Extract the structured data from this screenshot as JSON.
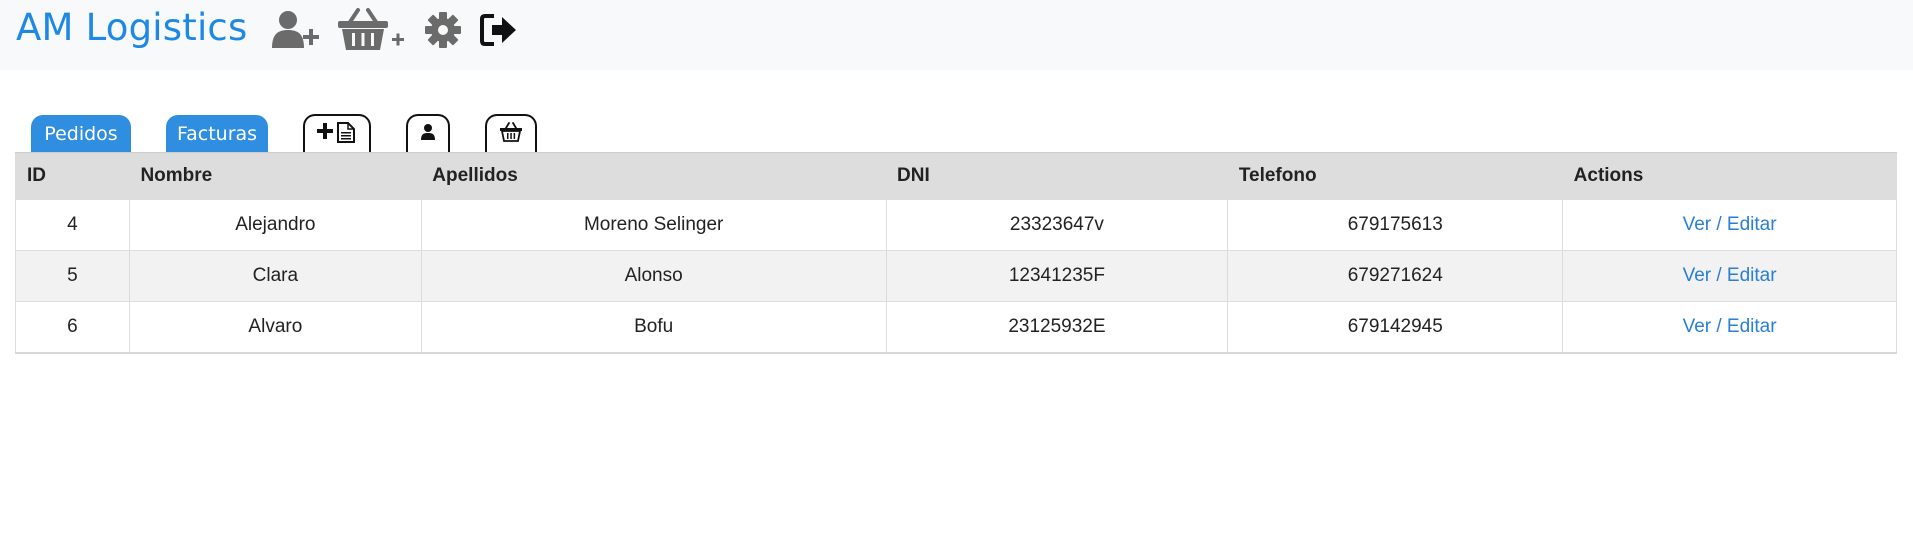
{
  "app": {
    "brand": "AM Logistics",
    "brand_color": "#1e88e5"
  },
  "nav_icons": [
    {
      "name": "add-user-icon"
    },
    {
      "name": "add-basket-icon",
      "suffix": "+"
    },
    {
      "name": "gear-icon"
    },
    {
      "name": "logout-icon"
    }
  ],
  "tabs": {
    "pedidos": "Pedidos",
    "facturas": "Facturas",
    "tab_color": "#2f8ee0"
  },
  "icon_tabs": [
    {
      "name": "new-invoice-icon"
    },
    {
      "name": "user-icon"
    },
    {
      "name": "basket-icon"
    }
  ],
  "table": {
    "headers": {
      "id": "ID",
      "nombre": "Nombre",
      "apellidos": "Apellidos",
      "dni": "DNI",
      "telefono": "Telefono",
      "actions": "Actions"
    },
    "rows": [
      {
        "id": "4",
        "nombre": "Alejandro",
        "apellidos": "Moreno Selinger",
        "dni": "23323647v",
        "telefono": "679175613",
        "action": "Ver / Editar"
      },
      {
        "id": "5",
        "nombre": "Clara",
        "apellidos": "Alonso",
        "dni": "12341235F",
        "telefono": "679271624",
        "action": "Ver / Editar"
      },
      {
        "id": "6",
        "nombre": "Alvaro",
        "apellidos": "Bofu",
        "dni": "23125932E",
        "telefono": "679142945",
        "action": "Ver / Editar"
      }
    ]
  }
}
